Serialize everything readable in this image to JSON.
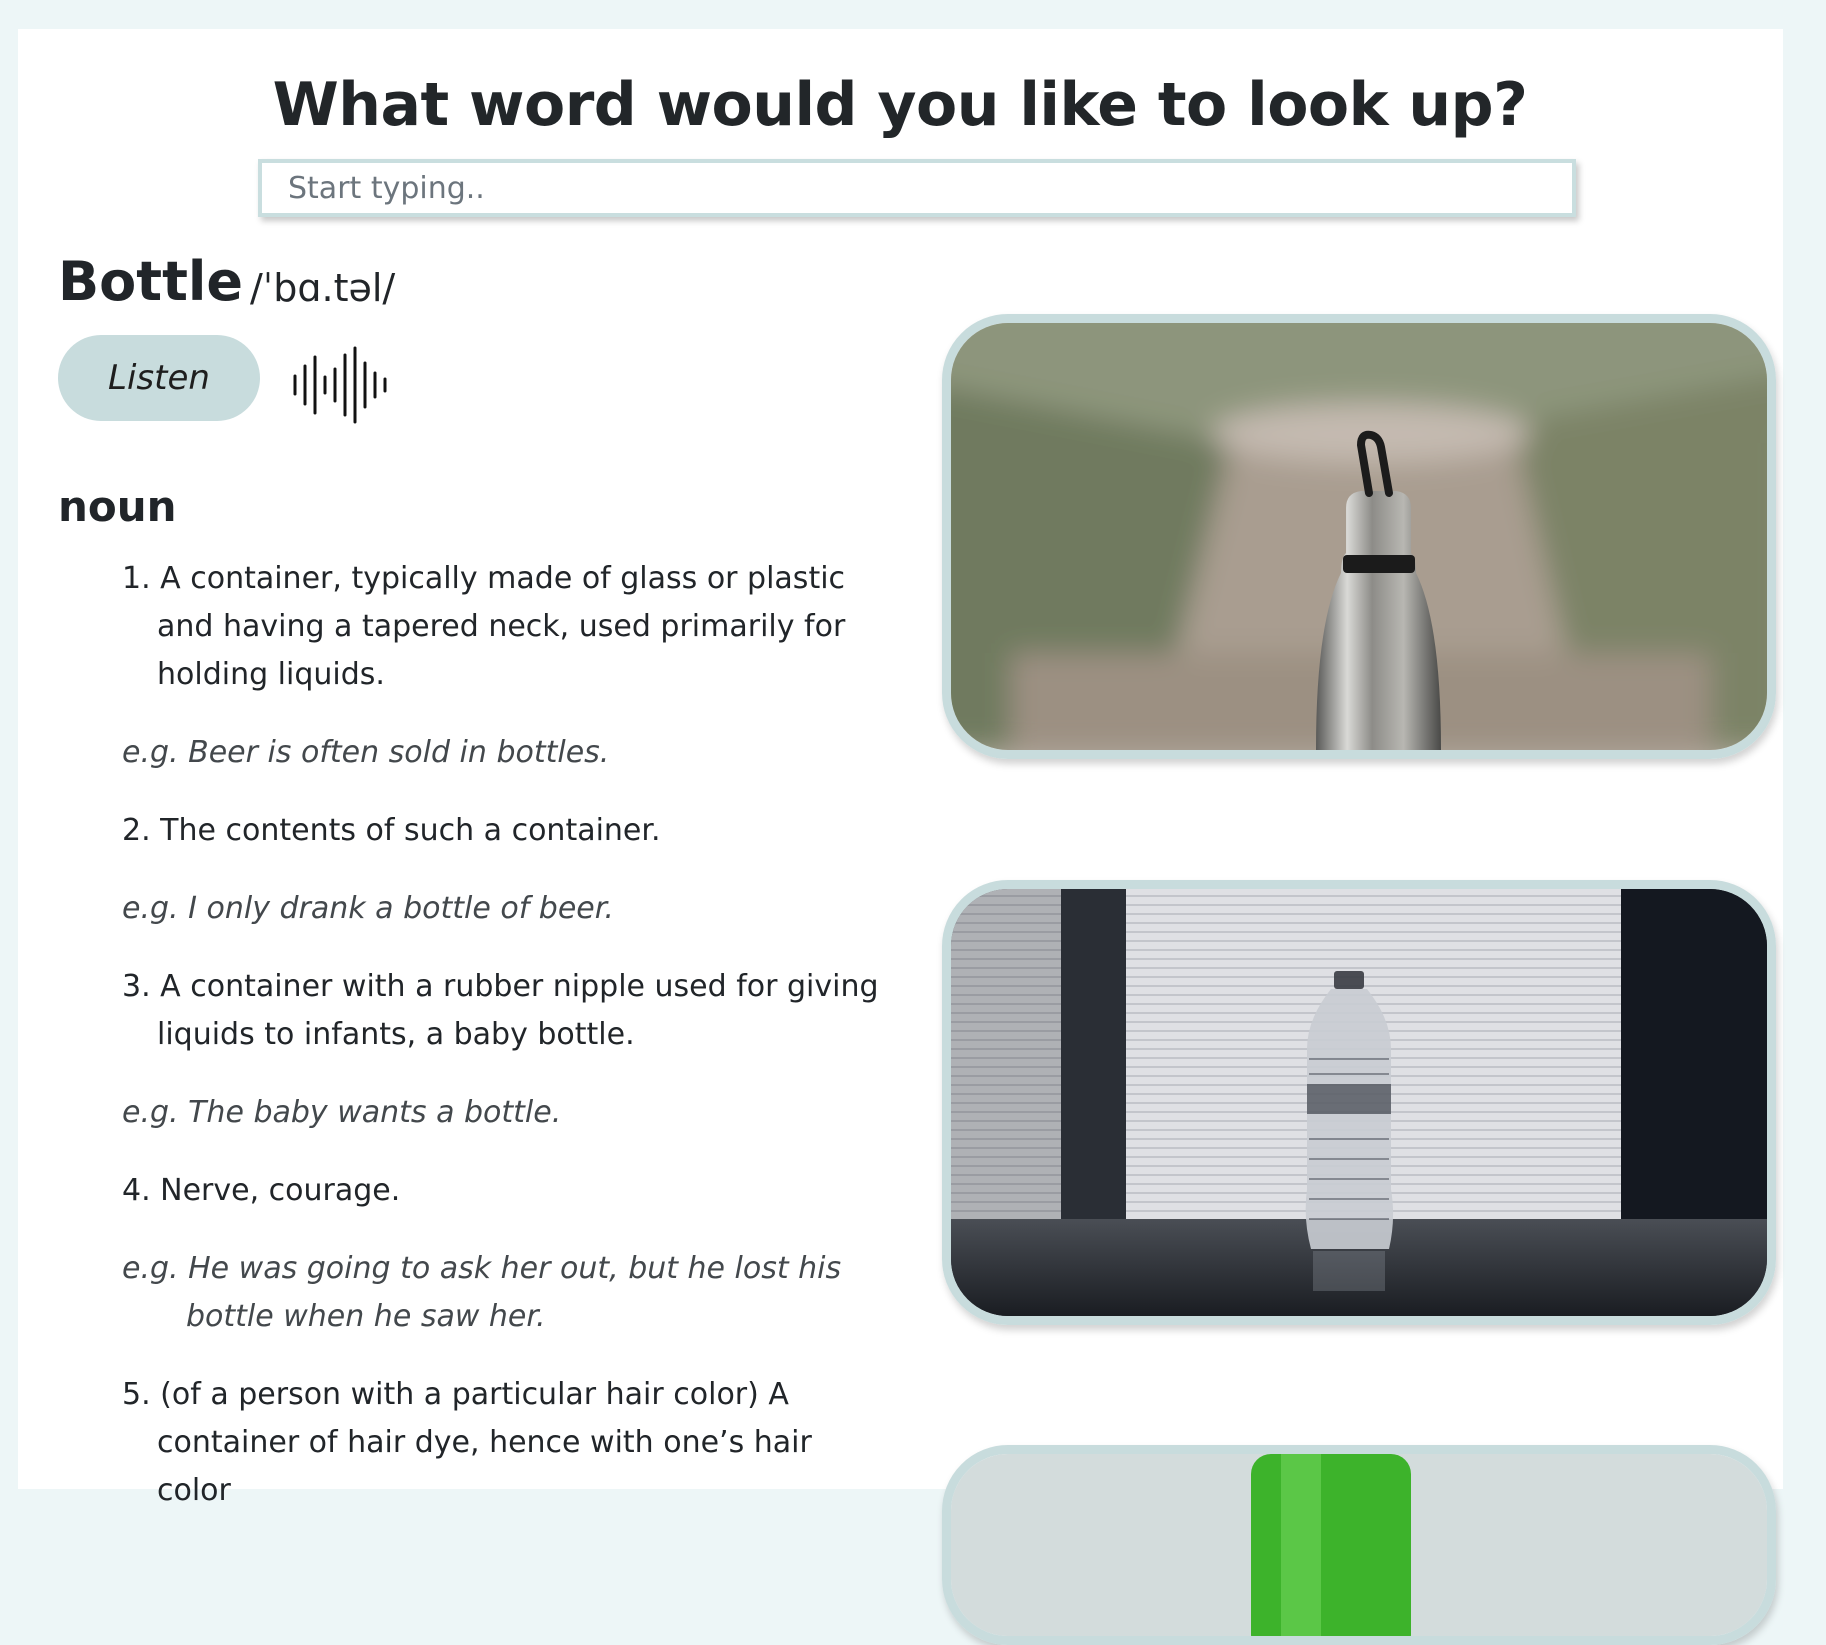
{
  "header": {
    "title": "What word would you like to look up?"
  },
  "search": {
    "placeholder": "Start typing.."
  },
  "entry": {
    "word": "Bottle",
    "phonetic": "/ˈbɑ.təl/",
    "listen_label": "Listen",
    "part_of_speech": "noun",
    "definitions": [
      {
        "text": "1. A container, typically made of glass or plastic and having a tapered neck, used primarily for holding liquids.",
        "example": "e.g. Beer is often sold in bottles."
      },
      {
        "text": "2. The contents of such a container.",
        "example": "e.g. I only drank a bottle of beer."
      },
      {
        "text": "3. A container with a rubber nipple used for giving liquids to infants, a baby bottle.",
        "example": "e.g. The baby wants a bottle."
      },
      {
        "text": "4. Nerve, courage.",
        "example": "e.g. He was going to ask her out, but he lost his bottle when he saw her."
      },
      {
        "text": "5. (of a person with a particular hair color) A container of hair dye, hence with one’s hair color"
      }
    ]
  },
  "colors": {
    "accent": "#c8dcdd",
    "page_background": "#edf6f7",
    "text": "#212529"
  },
  "icons": {
    "audio": "sound-wave-icon"
  }
}
